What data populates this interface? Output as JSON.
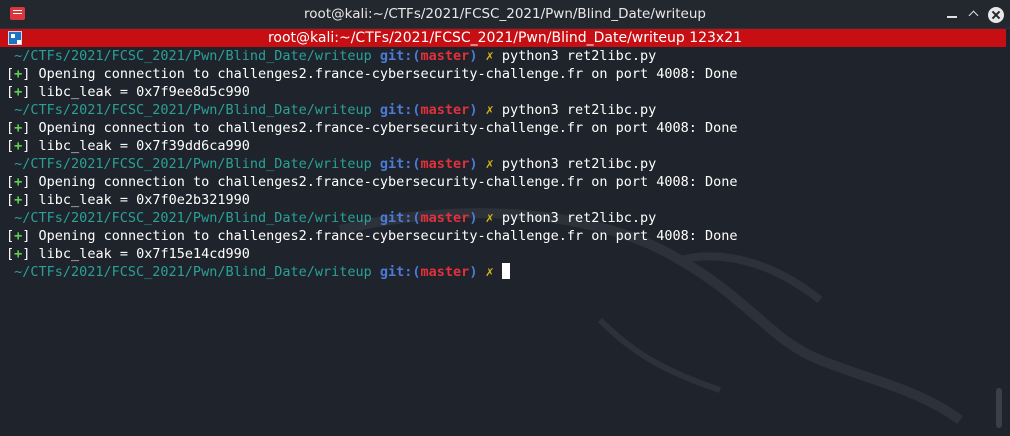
{
  "window": {
    "title": "root@kali:~/CTFs/2021/FCSC_2021/Pwn/Blind_Date/writeup"
  },
  "tab": {
    "title": "root@kali:~/CTFs/2021/FCSC_2021/Pwn/Blind_Date/writeup 123x21"
  },
  "colors": {
    "tab_bar": "#c70e13",
    "prompt_path": "#2aa198",
    "prompt_git": "#4c7bd6",
    "branch": "#e3303a",
    "prompt_arrow": "#d4b317",
    "status_green": "#5fd14f",
    "background": "#1f232b"
  },
  "terminal": {
    "prompt": {
      "path": " ~/CTFs/2021/FCSC_2021/Pwn/Blind_Date/writeup",
      "git_open": " git:(",
      "branch": "master",
      "git_close": ")",
      "arrow": " ✗"
    },
    "runs": [
      {
        "command": " python3 ret2libc.py",
        "status_open": "[",
        "status_mark": "+",
        "status_close": "]",
        "connection": " Opening connection to challenges2.france-cybersecurity-challenge.fr on port 4008: Done",
        "leak": " libc_leak = 0x7f9ee8d5c990"
      },
      {
        "command": " python3 ret2libc.py",
        "status_open": "[",
        "status_mark": "+",
        "status_close": "]",
        "connection": " Opening connection to challenges2.france-cybersecurity-challenge.fr on port 4008: Done",
        "leak": " libc_leak = 0x7f39dd6ca990"
      },
      {
        "command": " python3 ret2libc.py",
        "status_open": "[",
        "status_mark": "+",
        "status_close": "]",
        "connection": " Opening connection to challenges2.france-cybersecurity-challenge.fr on port 4008: Done",
        "leak": " libc_leak = 0x7f0e2b321990"
      },
      {
        "command": " python3 ret2libc.py",
        "status_open": "[",
        "status_mark": "+",
        "status_close": "]",
        "connection": " Opening connection to challenges2.france-cybersecurity-challenge.fr on port 4008: Done",
        "leak": " libc_leak = 0x7f15e14cd990"
      }
    ]
  }
}
